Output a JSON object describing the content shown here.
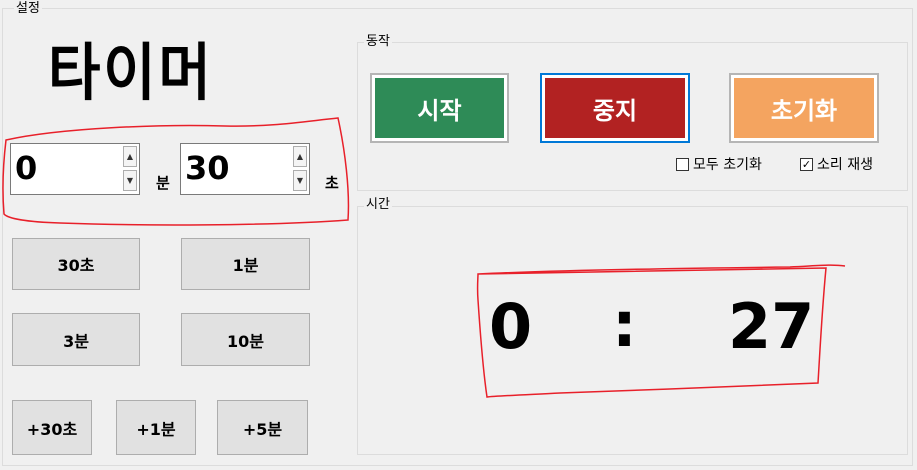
{
  "window": {
    "group_label": "설정"
  },
  "app_title": "타이머",
  "inputs": {
    "minutes": {
      "value": "0",
      "unit": "분"
    },
    "seconds": {
      "value": "30",
      "unit": "초"
    }
  },
  "presets": [
    "30초",
    "1분",
    "3분",
    "10분"
  ],
  "increments": [
    "+30초",
    "+1분",
    "+5분"
  ],
  "action_group": {
    "label": "동작",
    "start": "시작",
    "stop": "중지",
    "reset": "초기화",
    "colors": {
      "start": "#2e8b57",
      "stop": "#b22222",
      "reset": "#f4a460"
    }
  },
  "options": {
    "reset_all": {
      "label": "모두 초기화",
      "checked": false
    },
    "play_sound": {
      "label": "소리 재생",
      "checked": true
    }
  },
  "time_group": {
    "label": "시간",
    "minutes": "0",
    "separator": ":",
    "seconds": "27"
  },
  "annotation_color": "#e8202a"
}
